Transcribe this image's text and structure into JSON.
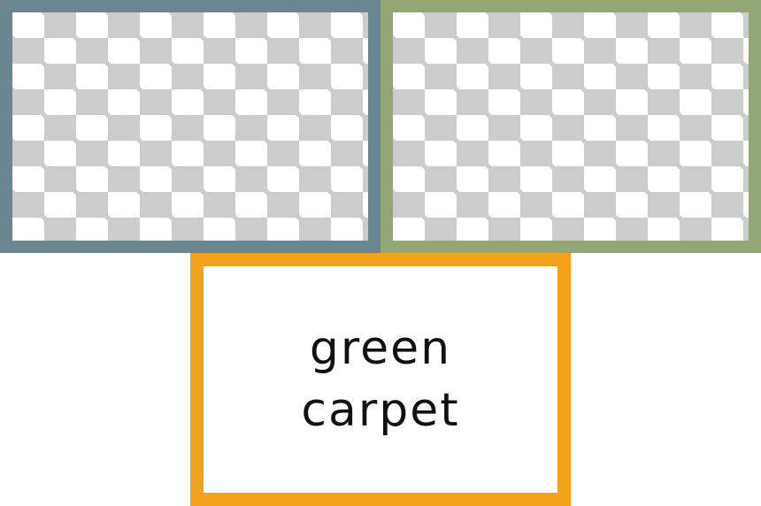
{
  "tiles": {
    "left": {
      "border_color": "#6a8791"
    },
    "right": {
      "border_color": "#92a775"
    }
  },
  "word_card": {
    "border_color": "#f3a21d",
    "line1": "green",
    "line2": "carpet"
  }
}
